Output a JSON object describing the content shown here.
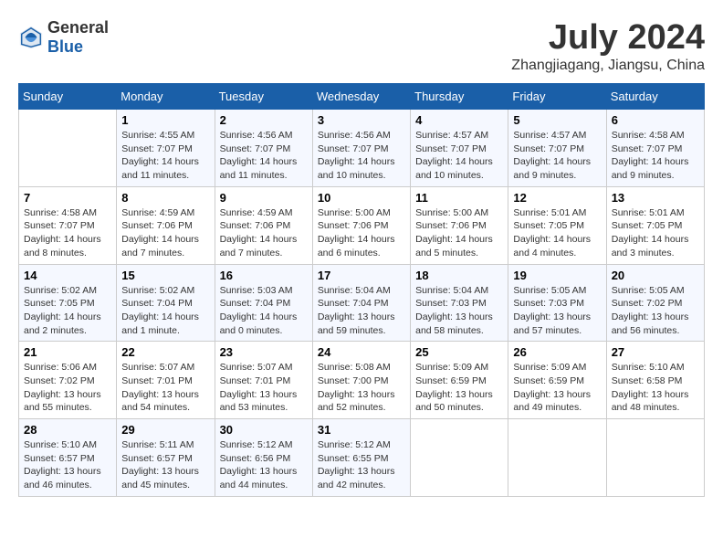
{
  "logo": {
    "general": "General",
    "blue": "Blue"
  },
  "title": "July 2024",
  "location": "Zhangjiagang, Jiangsu, China",
  "days_of_week": [
    "Sunday",
    "Monday",
    "Tuesday",
    "Wednesday",
    "Thursday",
    "Friday",
    "Saturday"
  ],
  "weeks": [
    [
      {
        "day": "",
        "info": ""
      },
      {
        "day": "1",
        "info": "Sunrise: 4:55 AM\nSunset: 7:07 PM\nDaylight: 14 hours\nand 11 minutes."
      },
      {
        "day": "2",
        "info": "Sunrise: 4:56 AM\nSunset: 7:07 PM\nDaylight: 14 hours\nand 11 minutes."
      },
      {
        "day": "3",
        "info": "Sunrise: 4:56 AM\nSunset: 7:07 PM\nDaylight: 14 hours\nand 10 minutes."
      },
      {
        "day": "4",
        "info": "Sunrise: 4:57 AM\nSunset: 7:07 PM\nDaylight: 14 hours\nand 10 minutes."
      },
      {
        "day": "5",
        "info": "Sunrise: 4:57 AM\nSunset: 7:07 PM\nDaylight: 14 hours\nand 9 minutes."
      },
      {
        "day": "6",
        "info": "Sunrise: 4:58 AM\nSunset: 7:07 PM\nDaylight: 14 hours\nand 9 minutes."
      }
    ],
    [
      {
        "day": "7",
        "info": "Sunrise: 4:58 AM\nSunset: 7:07 PM\nDaylight: 14 hours\nand 8 minutes."
      },
      {
        "day": "8",
        "info": "Sunrise: 4:59 AM\nSunset: 7:06 PM\nDaylight: 14 hours\nand 7 minutes."
      },
      {
        "day": "9",
        "info": "Sunrise: 4:59 AM\nSunset: 7:06 PM\nDaylight: 14 hours\nand 7 minutes."
      },
      {
        "day": "10",
        "info": "Sunrise: 5:00 AM\nSunset: 7:06 PM\nDaylight: 14 hours\nand 6 minutes."
      },
      {
        "day": "11",
        "info": "Sunrise: 5:00 AM\nSunset: 7:06 PM\nDaylight: 14 hours\nand 5 minutes."
      },
      {
        "day": "12",
        "info": "Sunrise: 5:01 AM\nSunset: 7:05 PM\nDaylight: 14 hours\nand 4 minutes."
      },
      {
        "day": "13",
        "info": "Sunrise: 5:01 AM\nSunset: 7:05 PM\nDaylight: 14 hours\nand 3 minutes."
      }
    ],
    [
      {
        "day": "14",
        "info": "Sunrise: 5:02 AM\nSunset: 7:05 PM\nDaylight: 14 hours\nand 2 minutes."
      },
      {
        "day": "15",
        "info": "Sunrise: 5:02 AM\nSunset: 7:04 PM\nDaylight: 14 hours\nand 1 minute."
      },
      {
        "day": "16",
        "info": "Sunrise: 5:03 AM\nSunset: 7:04 PM\nDaylight: 14 hours\nand 0 minutes."
      },
      {
        "day": "17",
        "info": "Sunrise: 5:04 AM\nSunset: 7:04 PM\nDaylight: 13 hours\nand 59 minutes."
      },
      {
        "day": "18",
        "info": "Sunrise: 5:04 AM\nSunset: 7:03 PM\nDaylight: 13 hours\nand 58 minutes."
      },
      {
        "day": "19",
        "info": "Sunrise: 5:05 AM\nSunset: 7:03 PM\nDaylight: 13 hours\nand 57 minutes."
      },
      {
        "day": "20",
        "info": "Sunrise: 5:05 AM\nSunset: 7:02 PM\nDaylight: 13 hours\nand 56 minutes."
      }
    ],
    [
      {
        "day": "21",
        "info": "Sunrise: 5:06 AM\nSunset: 7:02 PM\nDaylight: 13 hours\nand 55 minutes."
      },
      {
        "day": "22",
        "info": "Sunrise: 5:07 AM\nSunset: 7:01 PM\nDaylight: 13 hours\nand 54 minutes."
      },
      {
        "day": "23",
        "info": "Sunrise: 5:07 AM\nSunset: 7:01 PM\nDaylight: 13 hours\nand 53 minutes."
      },
      {
        "day": "24",
        "info": "Sunrise: 5:08 AM\nSunset: 7:00 PM\nDaylight: 13 hours\nand 52 minutes."
      },
      {
        "day": "25",
        "info": "Sunrise: 5:09 AM\nSunset: 6:59 PM\nDaylight: 13 hours\nand 50 minutes."
      },
      {
        "day": "26",
        "info": "Sunrise: 5:09 AM\nSunset: 6:59 PM\nDaylight: 13 hours\nand 49 minutes."
      },
      {
        "day": "27",
        "info": "Sunrise: 5:10 AM\nSunset: 6:58 PM\nDaylight: 13 hours\nand 48 minutes."
      }
    ],
    [
      {
        "day": "28",
        "info": "Sunrise: 5:10 AM\nSunset: 6:57 PM\nDaylight: 13 hours\nand 46 minutes."
      },
      {
        "day": "29",
        "info": "Sunrise: 5:11 AM\nSunset: 6:57 PM\nDaylight: 13 hours\nand 45 minutes."
      },
      {
        "day": "30",
        "info": "Sunrise: 5:12 AM\nSunset: 6:56 PM\nDaylight: 13 hours\nand 44 minutes."
      },
      {
        "day": "31",
        "info": "Sunrise: 5:12 AM\nSunset: 6:55 PM\nDaylight: 13 hours\nand 42 minutes."
      },
      {
        "day": "",
        "info": ""
      },
      {
        "day": "",
        "info": ""
      },
      {
        "day": "",
        "info": ""
      }
    ]
  ]
}
